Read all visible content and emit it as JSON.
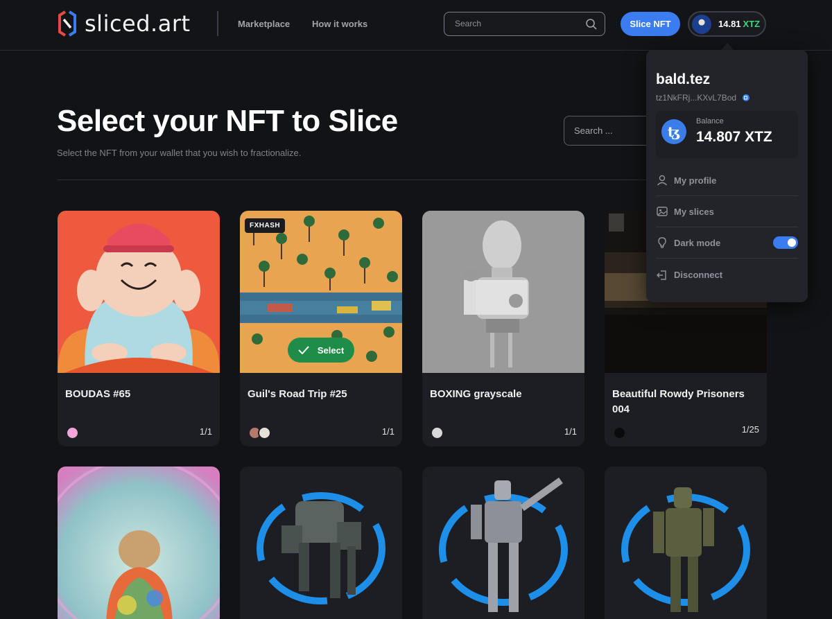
{
  "header": {
    "brand": "sliced.art",
    "nav": [
      "Marketplace",
      "How it works"
    ],
    "search_placeholder": "Search",
    "slice_button": "Slice NFT",
    "wallet_amount": "14.81",
    "wallet_currency": "XTZ"
  },
  "page": {
    "title": "Select your NFT to Slice",
    "subtitle": "Select the NFT from your wallet that you wish to fractionalize.",
    "search_placeholder": "Search ..."
  },
  "cards": [
    {
      "title": "BOUDAS #65",
      "edition": "1/1"
    },
    {
      "title": "Guil's Road Trip #25",
      "edition": "1/1",
      "badge": "FXHASH",
      "action": "Select"
    },
    {
      "title": "BOXING grayscale",
      "edition": "1/1"
    },
    {
      "title": "Beautiful Rowdy Prisoners 004",
      "edition": "1/25"
    }
  ],
  "dropdown": {
    "name": "bald.tez",
    "address": "tz1NkFRj...KXvL7Bod",
    "balance_label": "Balance",
    "balance_value": "14.807 XTZ",
    "items": [
      "My profile",
      "My slices",
      "Dark mode",
      "Disconnect"
    ]
  },
  "colors": {
    "accent": "#3b7cf1",
    "select_green": "#1f8d4a",
    "xtz_green": "#3fd676"
  },
  "icons": [
    "search-icon",
    "copy-icon",
    "tezos-icon",
    "user-icon",
    "image-icon",
    "bulb-icon",
    "logout-icon",
    "check-icon"
  ]
}
